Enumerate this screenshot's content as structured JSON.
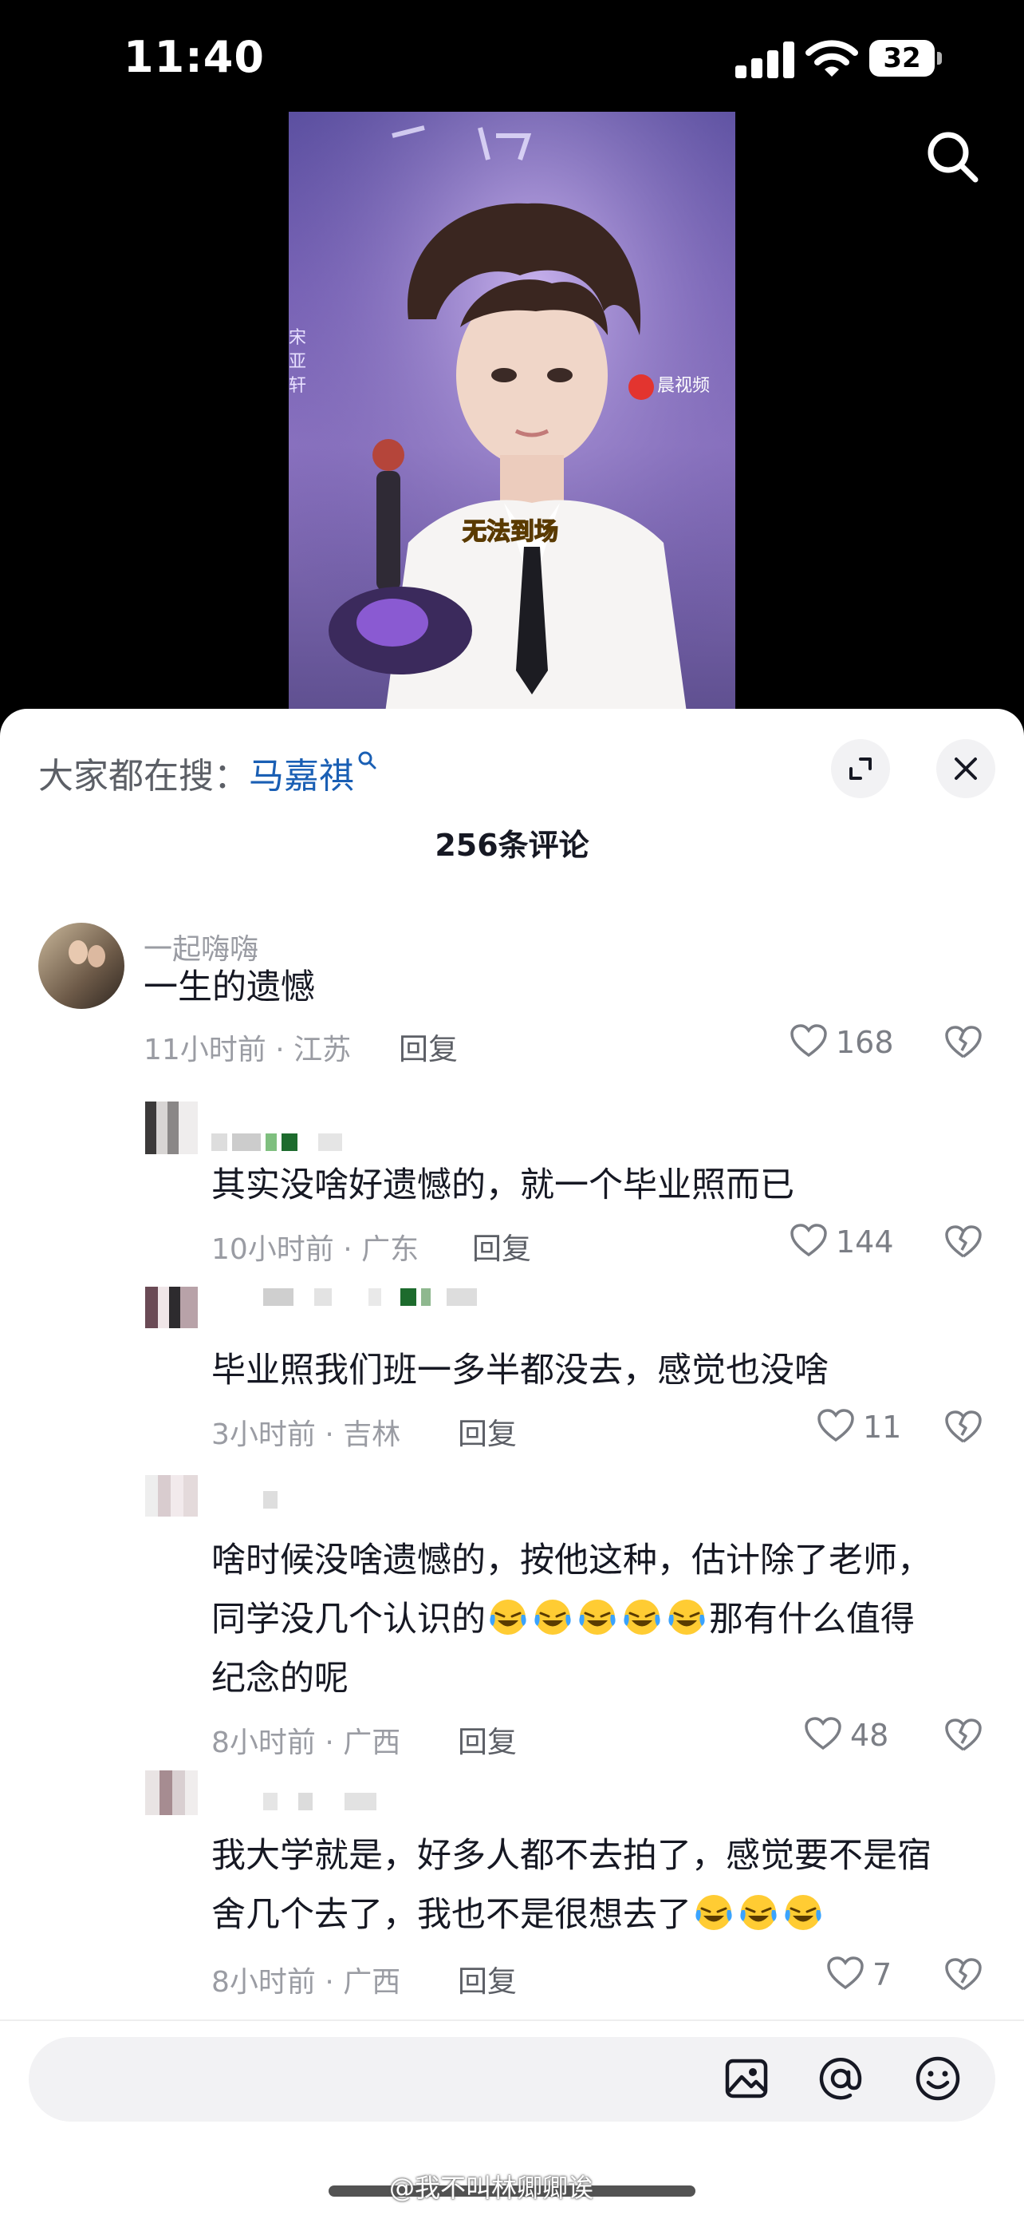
{
  "status": {
    "time": "11:40",
    "battery": "32"
  },
  "video": {
    "caption": "无法到场",
    "channel_logo": "晨视频"
  },
  "sheet": {
    "trending_prefix": "大家都在搜：",
    "trending_keyword": "马嘉祺",
    "comment_count": "256条评论"
  },
  "comments": [
    {
      "user": "一起嗨嗨",
      "text": "一生的遗憾",
      "time": "11小时前",
      "location": "江苏",
      "reply": "回复",
      "likes": "168"
    },
    {
      "user": "",
      "text": "其实没啥好遗憾的，就一个毕业照而已",
      "time": "10小时前",
      "location": "广东",
      "reply": "回复",
      "likes": "144"
    },
    {
      "user": "",
      "text": "毕业照我们班一多半都没去，感觉也没啥",
      "time": "3小时前",
      "location": "吉林",
      "reply": "回复",
      "likes": "11"
    },
    {
      "user": "",
      "text_line1": "啥时候没啥遗憾的，按他这种，估计除了老师，",
      "text_line2a": "同学没几个认识的",
      "text_line2b": "那有什么值得",
      "text_line3": "纪念的呢",
      "time": "8小时前",
      "location": "广西",
      "reply": "回复",
      "likes": "48"
    },
    {
      "user": "",
      "text_line1": "我大学就是，好多人都不去拍了，感觉要不是宿",
      "text_line2": "舍几个去了，我也不是很想去了",
      "time": "8小时前",
      "location": "广西",
      "reply": "回复",
      "likes": "7"
    }
  ],
  "meta_separator": " · ",
  "watermark": "@我不叫林卿卿诶",
  "icons": [
    "search-icon",
    "expand-icon",
    "close-icon",
    "heart-icon",
    "broken-heart-icon",
    "image-icon",
    "at-icon",
    "emoji-icon",
    "laughing-crying-emoji"
  ],
  "colors": {
    "accent_link": "#1a5fb4",
    "muted": "#9a9ca3",
    "text": "#161823"
  }
}
